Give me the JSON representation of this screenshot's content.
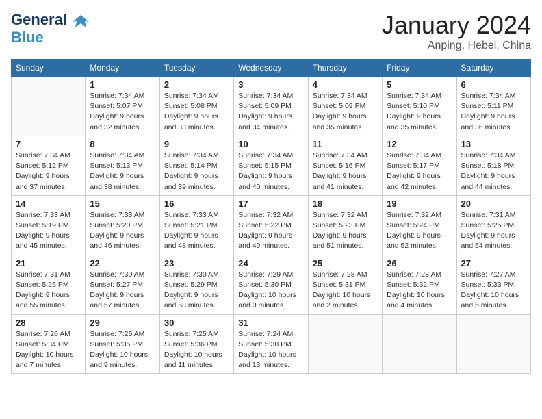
{
  "logo": {
    "general": "General",
    "blue": "Blue"
  },
  "title": "January 2024",
  "location": "Anping, Hebei, China",
  "weekdays": [
    "Sunday",
    "Monday",
    "Tuesday",
    "Wednesday",
    "Thursday",
    "Friday",
    "Saturday"
  ],
  "weeks": [
    [
      {
        "day": "",
        "info": ""
      },
      {
        "day": "1",
        "info": "Sunrise: 7:34 AM\nSunset: 5:07 PM\nDaylight: 9 hours\nand 32 minutes."
      },
      {
        "day": "2",
        "info": "Sunrise: 7:34 AM\nSunset: 5:08 PM\nDaylight: 9 hours\nand 33 minutes."
      },
      {
        "day": "3",
        "info": "Sunrise: 7:34 AM\nSunset: 5:09 PM\nDaylight: 9 hours\nand 34 minutes."
      },
      {
        "day": "4",
        "info": "Sunrise: 7:34 AM\nSunset: 5:09 PM\nDaylight: 9 hours\nand 35 minutes."
      },
      {
        "day": "5",
        "info": "Sunrise: 7:34 AM\nSunset: 5:10 PM\nDaylight: 9 hours\nand 35 minutes."
      },
      {
        "day": "6",
        "info": "Sunrise: 7:34 AM\nSunset: 5:11 PM\nDaylight: 9 hours\nand 36 minutes."
      }
    ],
    [
      {
        "day": "7",
        "info": "Sunrise: 7:34 AM\nSunset: 5:12 PM\nDaylight: 9 hours\nand 37 minutes."
      },
      {
        "day": "8",
        "info": "Sunrise: 7:34 AM\nSunset: 5:13 PM\nDaylight: 9 hours\nand 38 minutes."
      },
      {
        "day": "9",
        "info": "Sunrise: 7:34 AM\nSunset: 5:14 PM\nDaylight: 9 hours\nand 39 minutes."
      },
      {
        "day": "10",
        "info": "Sunrise: 7:34 AM\nSunset: 5:15 PM\nDaylight: 9 hours\nand 40 minutes."
      },
      {
        "day": "11",
        "info": "Sunrise: 7:34 AM\nSunset: 5:16 PM\nDaylight: 9 hours\nand 41 minutes."
      },
      {
        "day": "12",
        "info": "Sunrise: 7:34 AM\nSunset: 5:17 PM\nDaylight: 9 hours\nand 42 minutes."
      },
      {
        "day": "13",
        "info": "Sunrise: 7:34 AM\nSunset: 5:18 PM\nDaylight: 9 hours\nand 44 minutes."
      }
    ],
    [
      {
        "day": "14",
        "info": "Sunrise: 7:33 AM\nSunset: 5:19 PM\nDaylight: 9 hours\nand 45 minutes."
      },
      {
        "day": "15",
        "info": "Sunrise: 7:33 AM\nSunset: 5:20 PM\nDaylight: 9 hours\nand 46 minutes."
      },
      {
        "day": "16",
        "info": "Sunrise: 7:33 AM\nSunset: 5:21 PM\nDaylight: 9 hours\nand 48 minutes."
      },
      {
        "day": "17",
        "info": "Sunrise: 7:32 AM\nSunset: 5:22 PM\nDaylight: 9 hours\nand 49 minutes."
      },
      {
        "day": "18",
        "info": "Sunrise: 7:32 AM\nSunset: 5:23 PM\nDaylight: 9 hours\nand 51 minutes."
      },
      {
        "day": "19",
        "info": "Sunrise: 7:32 AM\nSunset: 5:24 PM\nDaylight: 9 hours\nand 52 minutes."
      },
      {
        "day": "20",
        "info": "Sunrise: 7:31 AM\nSunset: 5:25 PM\nDaylight: 9 hours\nand 54 minutes."
      }
    ],
    [
      {
        "day": "21",
        "info": "Sunrise: 7:31 AM\nSunset: 5:26 PM\nDaylight: 9 hours\nand 55 minutes."
      },
      {
        "day": "22",
        "info": "Sunrise: 7:30 AM\nSunset: 5:27 PM\nDaylight: 9 hours\nand 57 minutes."
      },
      {
        "day": "23",
        "info": "Sunrise: 7:30 AM\nSunset: 5:29 PM\nDaylight: 9 hours\nand 58 minutes."
      },
      {
        "day": "24",
        "info": "Sunrise: 7:29 AM\nSunset: 5:30 PM\nDaylight: 10 hours\nand 0 minutes."
      },
      {
        "day": "25",
        "info": "Sunrise: 7:28 AM\nSunset: 5:31 PM\nDaylight: 10 hours\nand 2 minutes."
      },
      {
        "day": "26",
        "info": "Sunrise: 7:28 AM\nSunset: 5:32 PM\nDaylight: 10 hours\nand 4 minutes."
      },
      {
        "day": "27",
        "info": "Sunrise: 7:27 AM\nSunset: 5:33 PM\nDaylight: 10 hours\nand 5 minutes."
      }
    ],
    [
      {
        "day": "28",
        "info": "Sunrise: 7:26 AM\nSunset: 5:34 PM\nDaylight: 10 hours\nand 7 minutes."
      },
      {
        "day": "29",
        "info": "Sunrise: 7:26 AM\nSunset: 5:35 PM\nDaylight: 10 hours\nand 9 minutes."
      },
      {
        "day": "30",
        "info": "Sunrise: 7:25 AM\nSunset: 5:36 PM\nDaylight: 10 hours\nand 11 minutes."
      },
      {
        "day": "31",
        "info": "Sunrise: 7:24 AM\nSunset: 5:38 PM\nDaylight: 10 hours\nand 13 minutes."
      },
      {
        "day": "",
        "info": ""
      },
      {
        "day": "",
        "info": ""
      },
      {
        "day": "",
        "info": ""
      }
    ]
  ]
}
